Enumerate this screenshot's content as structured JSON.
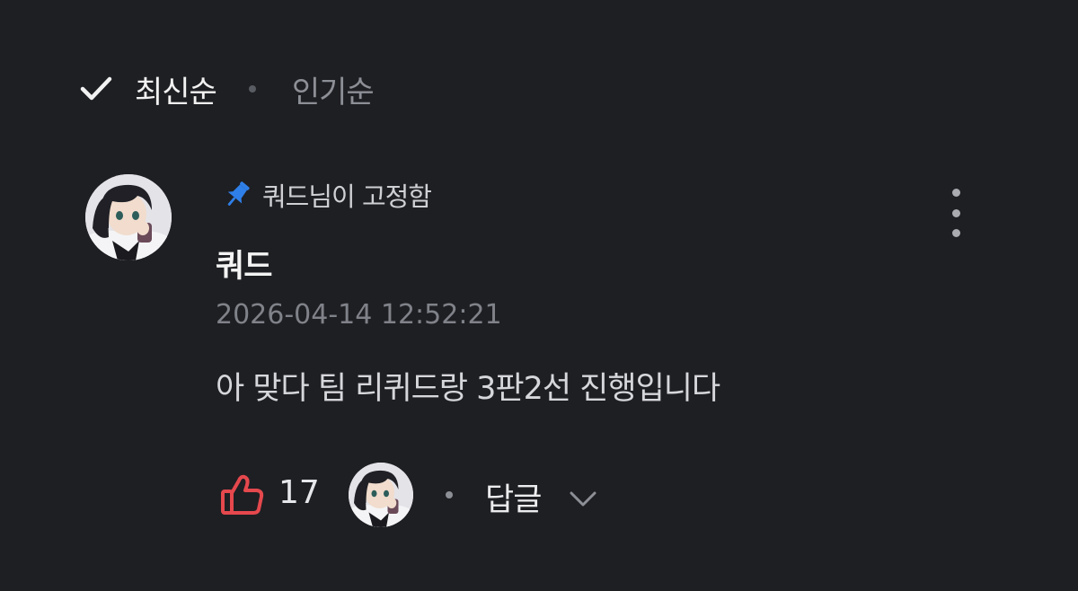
{
  "sort": {
    "latest_label": "최신순",
    "popular_label": "인기순"
  },
  "comment": {
    "pinned_text": "쿼드님이 고정함",
    "author": "쿼드",
    "timestamp": "2026-04-14 12:52:21",
    "body": "아 맞다 팀 리퀴드랑 3판2선 진행입니다",
    "like_count": "17",
    "reply_label": "답글"
  },
  "colors": {
    "background": "#1e1f23",
    "pin": "#2f7fe8",
    "like": "#e5484d"
  },
  "icons": {
    "sort_check": "check-icon",
    "pin": "pin-icon",
    "more": "more-vertical-icon",
    "like": "thumbs-up-icon",
    "reply_toggle": "chevron-down-icon"
  }
}
